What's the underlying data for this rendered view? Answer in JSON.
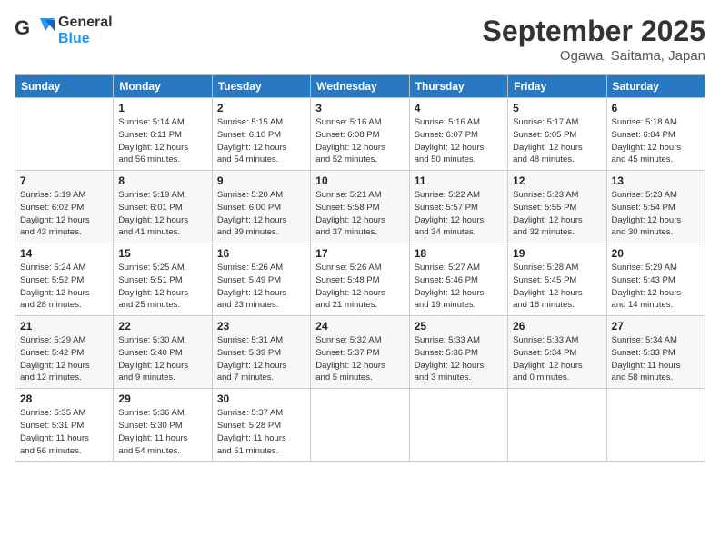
{
  "header": {
    "logo_general": "General",
    "logo_blue": "Blue",
    "month": "September 2025",
    "location": "Ogawa, Saitama, Japan"
  },
  "days_of_week": [
    "Sunday",
    "Monday",
    "Tuesday",
    "Wednesday",
    "Thursday",
    "Friday",
    "Saturday"
  ],
  "weeks": [
    [
      {
        "day": "",
        "info": ""
      },
      {
        "day": "1",
        "info": "Sunrise: 5:14 AM\nSunset: 6:11 PM\nDaylight: 12 hours\nand 56 minutes."
      },
      {
        "day": "2",
        "info": "Sunrise: 5:15 AM\nSunset: 6:10 PM\nDaylight: 12 hours\nand 54 minutes."
      },
      {
        "day": "3",
        "info": "Sunrise: 5:16 AM\nSunset: 6:08 PM\nDaylight: 12 hours\nand 52 minutes."
      },
      {
        "day": "4",
        "info": "Sunrise: 5:16 AM\nSunset: 6:07 PM\nDaylight: 12 hours\nand 50 minutes."
      },
      {
        "day": "5",
        "info": "Sunrise: 5:17 AM\nSunset: 6:05 PM\nDaylight: 12 hours\nand 48 minutes."
      },
      {
        "day": "6",
        "info": "Sunrise: 5:18 AM\nSunset: 6:04 PM\nDaylight: 12 hours\nand 45 minutes."
      }
    ],
    [
      {
        "day": "7",
        "info": "Sunrise: 5:19 AM\nSunset: 6:02 PM\nDaylight: 12 hours\nand 43 minutes."
      },
      {
        "day": "8",
        "info": "Sunrise: 5:19 AM\nSunset: 6:01 PM\nDaylight: 12 hours\nand 41 minutes."
      },
      {
        "day": "9",
        "info": "Sunrise: 5:20 AM\nSunset: 6:00 PM\nDaylight: 12 hours\nand 39 minutes."
      },
      {
        "day": "10",
        "info": "Sunrise: 5:21 AM\nSunset: 5:58 PM\nDaylight: 12 hours\nand 37 minutes."
      },
      {
        "day": "11",
        "info": "Sunrise: 5:22 AM\nSunset: 5:57 PM\nDaylight: 12 hours\nand 34 minutes."
      },
      {
        "day": "12",
        "info": "Sunrise: 5:23 AM\nSunset: 5:55 PM\nDaylight: 12 hours\nand 32 minutes."
      },
      {
        "day": "13",
        "info": "Sunrise: 5:23 AM\nSunset: 5:54 PM\nDaylight: 12 hours\nand 30 minutes."
      }
    ],
    [
      {
        "day": "14",
        "info": "Sunrise: 5:24 AM\nSunset: 5:52 PM\nDaylight: 12 hours\nand 28 minutes."
      },
      {
        "day": "15",
        "info": "Sunrise: 5:25 AM\nSunset: 5:51 PM\nDaylight: 12 hours\nand 25 minutes."
      },
      {
        "day": "16",
        "info": "Sunrise: 5:26 AM\nSunset: 5:49 PM\nDaylight: 12 hours\nand 23 minutes."
      },
      {
        "day": "17",
        "info": "Sunrise: 5:26 AM\nSunset: 5:48 PM\nDaylight: 12 hours\nand 21 minutes."
      },
      {
        "day": "18",
        "info": "Sunrise: 5:27 AM\nSunset: 5:46 PM\nDaylight: 12 hours\nand 19 minutes."
      },
      {
        "day": "19",
        "info": "Sunrise: 5:28 AM\nSunset: 5:45 PM\nDaylight: 12 hours\nand 16 minutes."
      },
      {
        "day": "20",
        "info": "Sunrise: 5:29 AM\nSunset: 5:43 PM\nDaylight: 12 hours\nand 14 minutes."
      }
    ],
    [
      {
        "day": "21",
        "info": "Sunrise: 5:29 AM\nSunset: 5:42 PM\nDaylight: 12 hours\nand 12 minutes."
      },
      {
        "day": "22",
        "info": "Sunrise: 5:30 AM\nSunset: 5:40 PM\nDaylight: 12 hours\nand 9 minutes."
      },
      {
        "day": "23",
        "info": "Sunrise: 5:31 AM\nSunset: 5:39 PM\nDaylight: 12 hours\nand 7 minutes."
      },
      {
        "day": "24",
        "info": "Sunrise: 5:32 AM\nSunset: 5:37 PM\nDaylight: 12 hours\nand 5 minutes."
      },
      {
        "day": "25",
        "info": "Sunrise: 5:33 AM\nSunset: 5:36 PM\nDaylight: 12 hours\nand 3 minutes."
      },
      {
        "day": "26",
        "info": "Sunrise: 5:33 AM\nSunset: 5:34 PM\nDaylight: 12 hours\nand 0 minutes."
      },
      {
        "day": "27",
        "info": "Sunrise: 5:34 AM\nSunset: 5:33 PM\nDaylight: 11 hours\nand 58 minutes."
      }
    ],
    [
      {
        "day": "28",
        "info": "Sunrise: 5:35 AM\nSunset: 5:31 PM\nDaylight: 11 hours\nand 56 minutes."
      },
      {
        "day": "29",
        "info": "Sunrise: 5:36 AM\nSunset: 5:30 PM\nDaylight: 11 hours\nand 54 minutes."
      },
      {
        "day": "30",
        "info": "Sunrise: 5:37 AM\nSunset: 5:28 PM\nDaylight: 11 hours\nand 51 minutes."
      },
      {
        "day": "",
        "info": ""
      },
      {
        "day": "",
        "info": ""
      },
      {
        "day": "",
        "info": ""
      },
      {
        "day": "",
        "info": ""
      }
    ]
  ]
}
